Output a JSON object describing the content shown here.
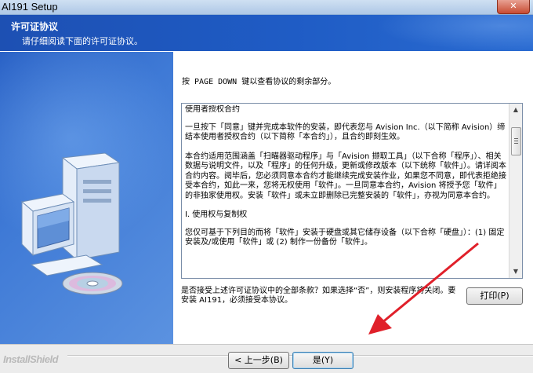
{
  "window": {
    "title": "AI191 Setup",
    "close_symbol": "✕"
  },
  "header": {
    "title": "许可证协议",
    "subtitle": "请仔细阅读下面的许可证协议。"
  },
  "content": {
    "instruction": "按 PAGE DOWN 键以查看协议的剩余部分。",
    "license_paragraphs": [
      "使用者授权合约",
      "一旦按下「同意」键并完成本软件的安装，即代表您与 Avision Inc.（以下简称 Avision）缔结本使用者授权合约（以下简称「本合约」），且合约即刻生效。",
      "本合约适用范围涵盖「扫瞄器驱动程序」与「Avision 撷取工具」（以下合称「程序」）、相关数据与说明文件，以及「程序」的任何升级，更新或修改版本（以下统称「软件」）。请详阅本合约内容。阅毕后，您必须同意本合约才能继续完成安装作业，如果您不同意，即代表拒绝接受本合约，如此一来，您将无权使用「软件」。一旦同意本合约，Avision 将授予您「软件」的非独家使用权。安装「软件」或未立即删除已完整安装的「软件」，亦视为同意本合约。",
      "I. 使用权与复制权",
      "您仅可基于下列目的而将「软件」安装于硬盘或其它储存设备（以下合称「硬盘」）：(1) 固定安装及/或使用「软件」或 (2) 制作一份备份「软件」。"
    ],
    "prompt": "是否接受上述许可证协议中的全部条款？如果选择“否”，则安装程序将关闭。要安装 AI191，必须接受本协议。",
    "print_label": "打印(P)"
  },
  "footer": {
    "brand": "InstallShield",
    "back_label": "< 上一步(B)",
    "yes_label": "是(Y)"
  },
  "colors": {
    "header_blue": "#1f5cc5",
    "annotation_red": "#e0202a"
  }
}
